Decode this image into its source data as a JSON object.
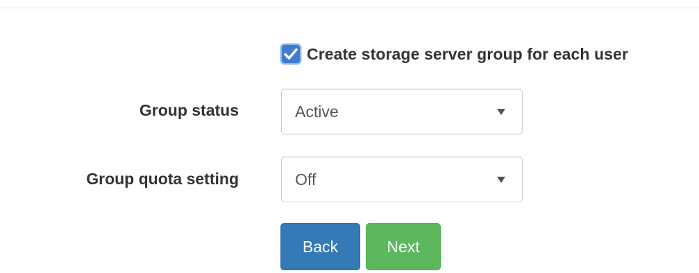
{
  "create_group": {
    "checked": true,
    "label": "Create storage server group for each user"
  },
  "fields": {
    "group_status": {
      "label": "Group status",
      "value": "Active"
    },
    "group_quota": {
      "label": "Group quota setting",
      "value": "Off"
    }
  },
  "buttons": {
    "back": "Back",
    "next": "Next"
  },
  "colors": {
    "primary": "#337ab7",
    "success": "#5cb85c",
    "checkbox": "#3f7bd0"
  },
  "icons": {
    "checkbox": "checkmark-icon",
    "dropdown": "caret-down-icon"
  }
}
